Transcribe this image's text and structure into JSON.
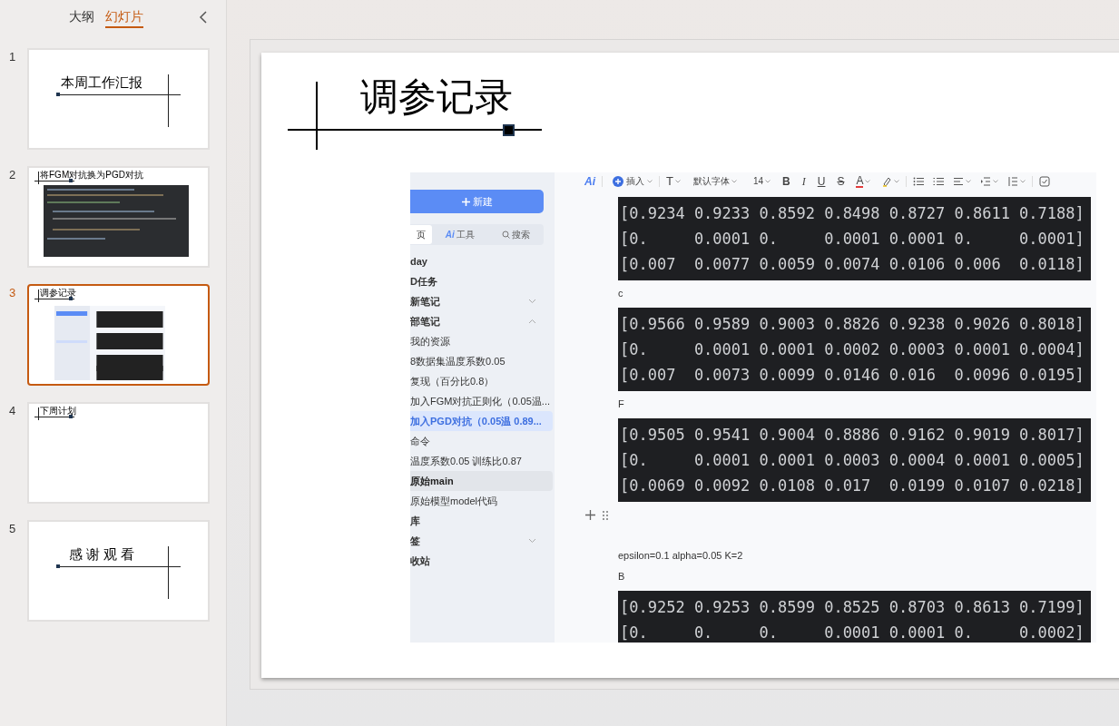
{
  "panel_tabs": [
    {
      "label": "大纲",
      "selected": false
    },
    {
      "label": "幻灯片",
      "selected": true
    }
  ],
  "slides": [
    {
      "number": "1",
      "kind": "cover",
      "title": "本周工作汇报",
      "selected": false
    },
    {
      "number": "2",
      "kind": "screenshot",
      "title": "将FGM对抗换为PGD对抗",
      "selected": false
    },
    {
      "number": "3",
      "kind": "screenshot",
      "title": "调参记录",
      "selected": true
    },
    {
      "number": "4",
      "kind": "text",
      "title": "下周计划",
      "selected": false
    },
    {
      "number": "5",
      "kind": "cover",
      "title": "感 谢 观 看",
      "selected": false
    }
  ],
  "current_slide": {
    "title": "调参记录",
    "screenshot": {
      "sidebar": {
        "new_button": "新建",
        "tabs": [
          {
            "label": "页",
            "selected": true
          },
          {
            "label": "工具",
            "badge": "Ai",
            "selected": false
          },
          {
            "label": "搜索",
            "selected": false
          }
        ],
        "items": [
          {
            "label": "day",
            "kind": "section",
            "selected": false,
            "hovered": false
          },
          {
            "label": "D任务",
            "kind": "section",
            "selected": false,
            "hovered": false
          },
          {
            "label": "新笔记",
            "kind": "section",
            "expanded": false,
            "selected": false,
            "hovered": false
          },
          {
            "label": "部笔记",
            "kind": "section",
            "expanded": true,
            "selected": false,
            "hovered": false
          },
          {
            "label": "我的资源",
            "kind": "note",
            "selected": false,
            "hovered": false
          },
          {
            "label": "8数据集温度系数0.05",
            "kind": "note",
            "selected": false,
            "hovered": false
          },
          {
            "label": "复现（百分比0.8）",
            "kind": "note",
            "selected": false,
            "hovered": false
          },
          {
            "label": "加入FGM对抗正则化（0.05温...",
            "kind": "note",
            "selected": false,
            "hovered": false
          },
          {
            "label": "加入PGD对抗（0.05温 0.89...",
            "kind": "note",
            "selected": true,
            "hovered": false
          },
          {
            "label": "命令",
            "kind": "note",
            "selected": false,
            "hovered": false
          },
          {
            "label": "温度系数0.05 训练比0.87",
            "kind": "note",
            "selected": false,
            "hovered": false
          },
          {
            "label": "原始main",
            "kind": "section",
            "selected": false,
            "hovered": true
          },
          {
            "label": "原始模型model代码",
            "kind": "note",
            "selected": false,
            "hovered": false
          },
          {
            "label": "库",
            "kind": "section",
            "selected": false,
            "hovered": false
          },
          {
            "label": "签",
            "kind": "section",
            "expanded": false,
            "selected": false,
            "hovered": false
          },
          {
            "label": "收站",
            "kind": "section",
            "selected": false,
            "hovered": false
          }
        ]
      },
      "toolbar": {
        "ai": "Ai",
        "insert": "插入",
        "text_style": "T",
        "font": "默认字体",
        "size": "14",
        "format": [
          "B",
          "I",
          "U",
          "S",
          "A"
        ]
      },
      "content": [
        {
          "kind": "code",
          "lines": [
            "[0.9234 0.9233 0.8592 0.8498 0.8727 0.8611 0.7188]",
            "[0.     0.0001 0.     0.0001 0.0001 0.     0.0001]",
            "[0.007  0.0077 0.0059 0.0074 0.0106 0.006  0.0118]"
          ]
        },
        {
          "kind": "text",
          "text": "c"
        },
        {
          "kind": "code",
          "lines": [
            "[0.9566 0.9589 0.9003 0.8826 0.9238 0.9026 0.8018]",
            "[0.     0.0001 0.0001 0.0002 0.0003 0.0001 0.0004]",
            "[0.007  0.0073 0.0099 0.0146 0.016  0.0096 0.0195]"
          ]
        },
        {
          "kind": "text",
          "text": "F"
        },
        {
          "kind": "code",
          "lines": [
            "[0.9505 0.9541 0.9004 0.8886 0.9162 0.9019 0.8017]",
            "[0.     0.0001 0.0001 0.0003 0.0004 0.0001 0.0005]",
            "[0.0069 0.0092 0.0108 0.017  0.0199 0.0107 0.0218]"
          ]
        },
        {
          "kind": "handle"
        },
        {
          "kind": "text",
          "text": "epsilon=0.1 alpha=0.05 K=2"
        },
        {
          "kind": "text",
          "text": "B"
        },
        {
          "kind": "code",
          "lines": [
            "[0.9252 0.9253 0.8599 0.8525 0.8703 0.8613 0.7199]",
            "[0.     0.     0.     0.0001 0.0001 0.     0.0002]"
          ]
        }
      ]
    }
  }
}
